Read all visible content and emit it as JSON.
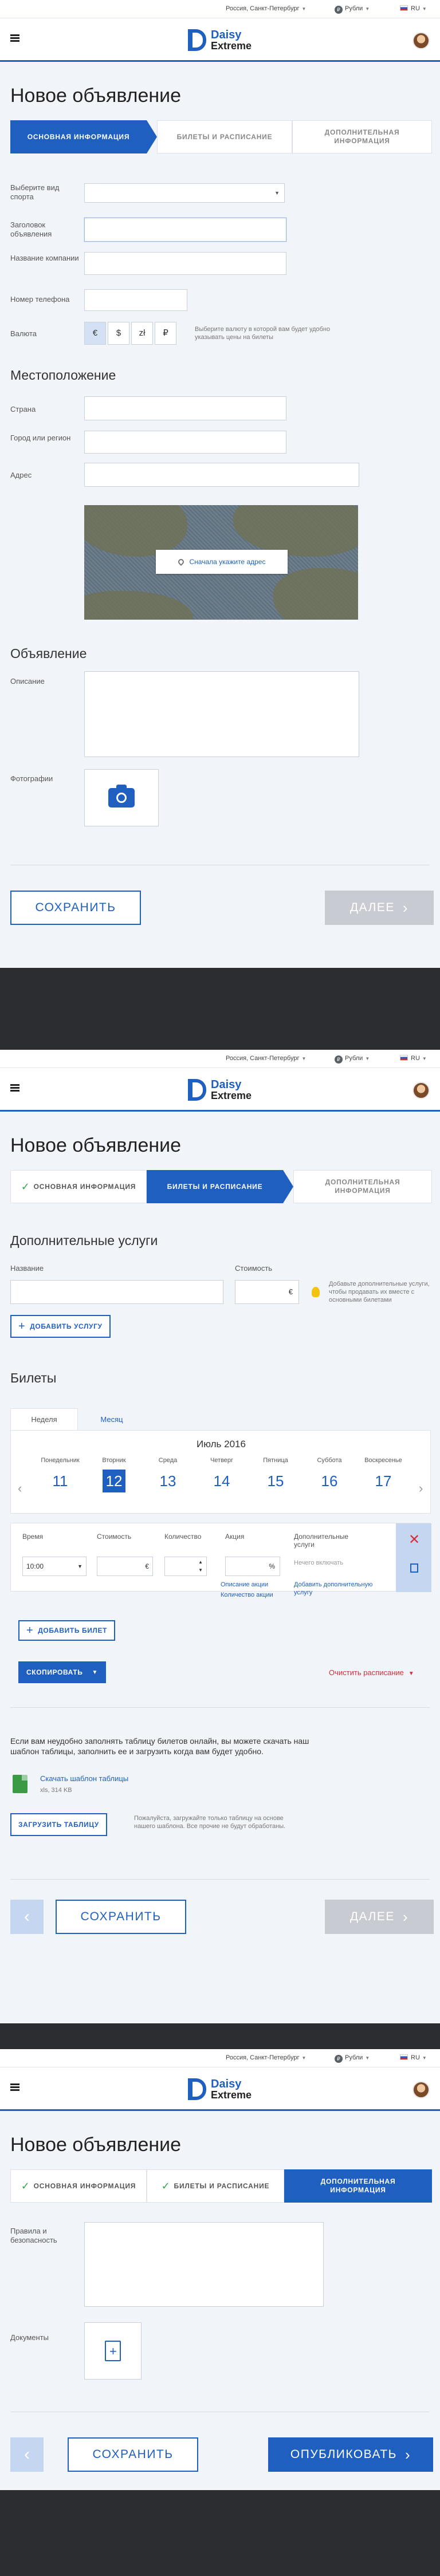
{
  "topbar": {
    "location": "Россия, Санкт-Петербург",
    "currency": "Рубли",
    "language": "RU"
  },
  "logo": {
    "line1": "Daisy",
    "line2": "Extreme"
  },
  "page_title": "Новое объявление",
  "steps": [
    "Основная информация",
    "Билеты и расписание",
    "Дополнительная информация"
  ],
  "screen1": {
    "fields": {
      "sport_label": "Выберите вид спорта",
      "title_label": "Заголовок объявления",
      "company_label": "Название компании",
      "phone_label": "Номер телефона",
      "currency_label": "Валюта",
      "currency_options": [
        "€",
        "$",
        "zł",
        "₽"
      ],
      "currency_hint": "Выберите валюту в которой вам будет удобно указывать цены на билеты"
    },
    "location": {
      "heading": "Местоположение",
      "country_label": "Страна",
      "city_label": "Город или регион",
      "address_label": "Адрес",
      "map_button": "Сначала укажите адрес"
    },
    "ad": {
      "heading": "Объявление",
      "description_label": "Описание",
      "photos_label": "Фотографии"
    },
    "buttons": {
      "save": "Сохранить",
      "next": "Далее"
    }
  },
  "screen2": {
    "services": {
      "heading": "Дополнительные услуги",
      "name_label": "Название",
      "price_label": "Стоимость",
      "price_currency": "€",
      "hint": "Добавьте дополнительные услуги, чтобы продавать их вместе с основными билетами",
      "add_button": "Добавить услугу"
    },
    "tickets": {
      "heading": "Билеты",
      "tabs": [
        "Неделя",
        "Месяц"
      ],
      "month": "Июль 2016",
      "days": [
        {
          "wd": "Понедельник",
          "num": "11"
        },
        {
          "wd": "Вторник",
          "num": "12"
        },
        {
          "wd": "Среда",
          "num": "13"
        },
        {
          "wd": "Четверг",
          "num": "14"
        },
        {
          "wd": "Пятница",
          "num": "15"
        },
        {
          "wd": "Суббота",
          "num": "16"
        },
        {
          "wd": "Воскресенье",
          "num": "17"
        }
      ],
      "columns": {
        "time": "Время",
        "price": "Стоимость",
        "qty": "Количество",
        "promo": "Акция",
        "extra": "Дополнительные услуги"
      },
      "row": {
        "time": "10:00",
        "price_currency": "€",
        "promo_unit": "%",
        "extra_placeholder": "Нечего включать",
        "promo_desc_link": "Описание акции",
        "promo_qty_link": "Количество акции",
        "add_extra_link": "Добавить дополнительную услугу"
      },
      "add_ticket": "Добавить билет",
      "copy": "Скопировать",
      "clear": "Очистить расписание"
    },
    "upload": {
      "text": "Если вам неудобно заполнять таблицу билетов онлайн, вы можете скачать наш шаблон таблицы, заполнить ее и загрузить когда вам будет удобно.",
      "template_link": "Скачать шаблон таблицы",
      "template_size": "xls, 314 KB",
      "button": "Загрузить таблицу",
      "hint": "Пожалуйста, загружайте только таблицу на основе нашего шаблона. Все прочие не будут обработаны."
    },
    "buttons": {
      "save": "Сохранить",
      "next": "Далее"
    }
  },
  "screen3": {
    "rules_label": "Правила и безопасность",
    "documents_label": "Документы",
    "buttons": {
      "save": "Сохранить",
      "publish": "Опубликовать"
    }
  },
  "colors": {
    "accent": "#1f5fc0",
    "page_bg": "#f1f4f8",
    "success": "#2ea84a",
    "danger": "#d0303a",
    "dark_band": "#2b2d31"
  }
}
